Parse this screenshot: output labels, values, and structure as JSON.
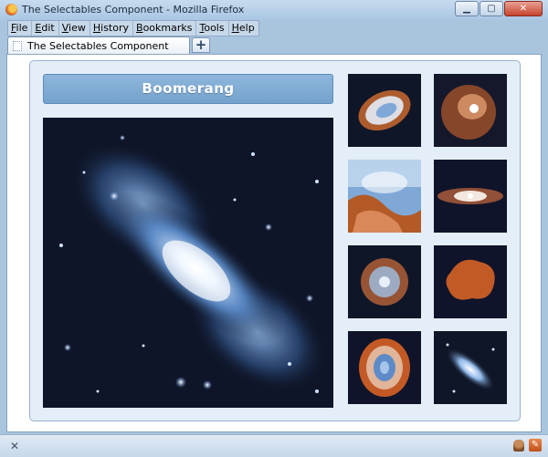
{
  "window": {
    "title": "The Selectables Component - Mozilla Firefox",
    "minimize_glyph": "▁",
    "maximize_glyph": "▢",
    "close_glyph": "✕"
  },
  "menubar": {
    "items": [
      {
        "underline": "F",
        "rest": "ile"
      },
      {
        "underline": "E",
        "rest": "dit"
      },
      {
        "underline": "V",
        "rest": "iew"
      },
      {
        "underline": "H",
        "rest": "istory"
      },
      {
        "underline": "B",
        "rest": "ookmarks"
      },
      {
        "underline": "T",
        "rest": "ools"
      },
      {
        "underline": "H",
        "rest": "elp"
      }
    ]
  },
  "tabs": {
    "active_label": "The Selectables Component",
    "new_tab_glyph": "+"
  },
  "gallery": {
    "selected_title": "Boomerang",
    "main_image_icon": "boomerang-nebula-image",
    "thumbnails": [
      {
        "name": "crab-nebula-thumb",
        "icon": "crab-nebula"
      },
      {
        "name": "orion-nebula-thumb",
        "icon": "orion-nebula"
      },
      {
        "name": "eagle-nebula-thumb",
        "icon": "eagle-nebula-pillars"
      },
      {
        "name": "sombrero-galaxy-thumb",
        "icon": "edge-on-galaxy"
      },
      {
        "name": "supernova-remnant-thumb",
        "icon": "supernova-remnant"
      },
      {
        "name": "red-nebula-thumb",
        "icon": "red-cloud-nebula"
      },
      {
        "name": "ring-nebula-thumb",
        "icon": "ring-nebula"
      },
      {
        "name": "boomerang-nebula-thumb",
        "icon": "boomerang-nebula"
      }
    ]
  },
  "statusbar": {
    "close_glyph": "✕",
    "addon_icon": "addon-icon",
    "edit_icon": "pencil-icon"
  }
}
